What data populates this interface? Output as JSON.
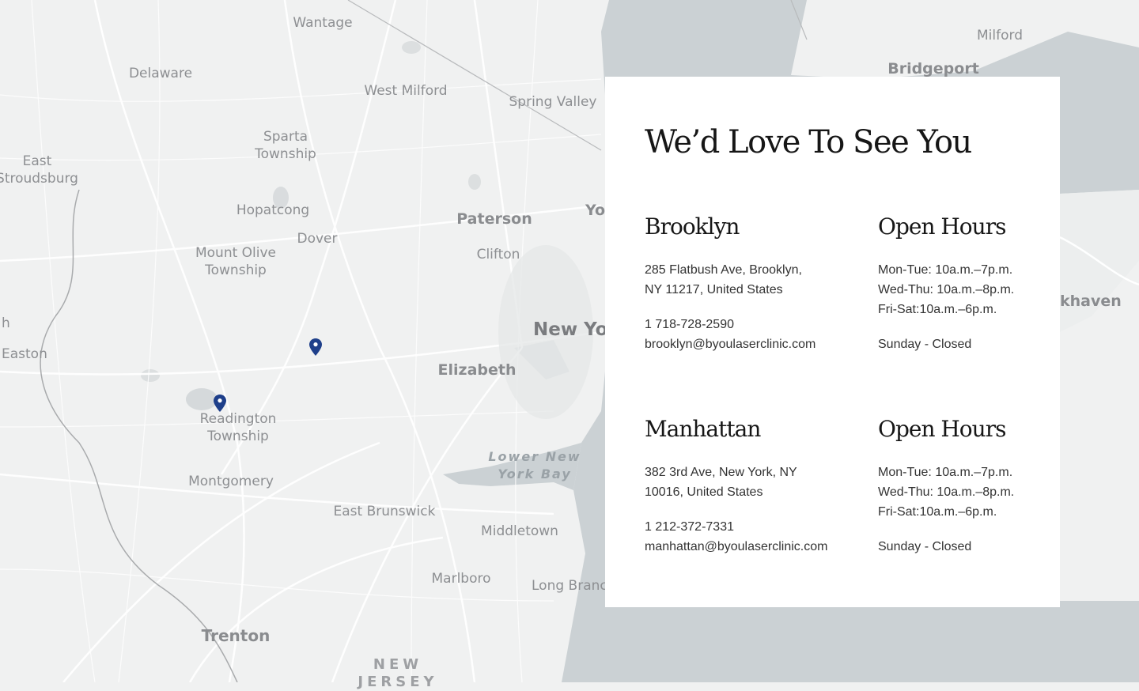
{
  "map": {
    "labels": {
      "wantage": "Wantage",
      "delaware": "Delaware",
      "west_milford": "West Milford",
      "spring_valley": "Spring Valley",
      "milford": "Milford",
      "bridgeport": "Bridgeport",
      "sparta": "Sparta\nTownship",
      "east_stroudsburg": "East\nStroudsburg",
      "hopatcong": "Hopatcong",
      "dover": "Dover",
      "mount_olive": "Mount Olive\nTownship",
      "paterson": "Paterson",
      "yonkers_fragment": "Yo",
      "clifton": "Clifton",
      "new_york": "New York",
      "elizabeth": "Elizabeth",
      "easton": "Easton",
      "h_fragment": "h",
      "readington": "Readington\nTownship",
      "montgomery": "Montgomery",
      "lower_new_york_bay": "Lower New\nYork Bay",
      "east_brunswick": "East Brunswick",
      "middletown": "Middletown",
      "marlboro": "Marlboro",
      "long_branch": "Long Branch",
      "trenton": "Trenton",
      "new_jersey": "NEW\nJERSEY",
      "haven_fragment": "khaven"
    },
    "pins": [
      {
        "name": "location-pin"
      },
      {
        "name": "location-pin"
      }
    ],
    "colors": {
      "land": "#f0f1f1",
      "water": "#cbd1d4",
      "road": "#ffffff",
      "pin": "#1e3f8a"
    }
  },
  "card": {
    "title": "We’d Love To See You",
    "locations": [
      {
        "name": "Brooklyn",
        "address_line1": "285 Flatbush Ave, Brooklyn,",
        "address_line2": "NY 11217, United States",
        "phone": "1 718-728-2590",
        "email": "brooklyn@byoulaserclinic.com",
        "hours_title": "Open Hours",
        "hours": [
          "Mon-Tue: 10a.m.–7p.m.",
          "Wed-Thu: 10a.m.–8p.m.",
          "Fri-Sat:10a.m.–6p.m."
        ],
        "closed": "Sunday - Closed"
      },
      {
        "name": "Manhattan",
        "address_line1": "382 3rd Ave, New York, NY",
        "address_line2": "10016, United States",
        "phone": "1 212-372-7331",
        "email": "manhattan@byoulaserclinic.com",
        "hours_title": "Open Hours",
        "hours": [
          "Mon-Tue: 10a.m.–7p.m.",
          "Wed-Thu: 10a.m.–8p.m.",
          "Fri-Sat:10a.m.–6p.m."
        ],
        "closed": "Sunday - Closed"
      }
    ]
  }
}
